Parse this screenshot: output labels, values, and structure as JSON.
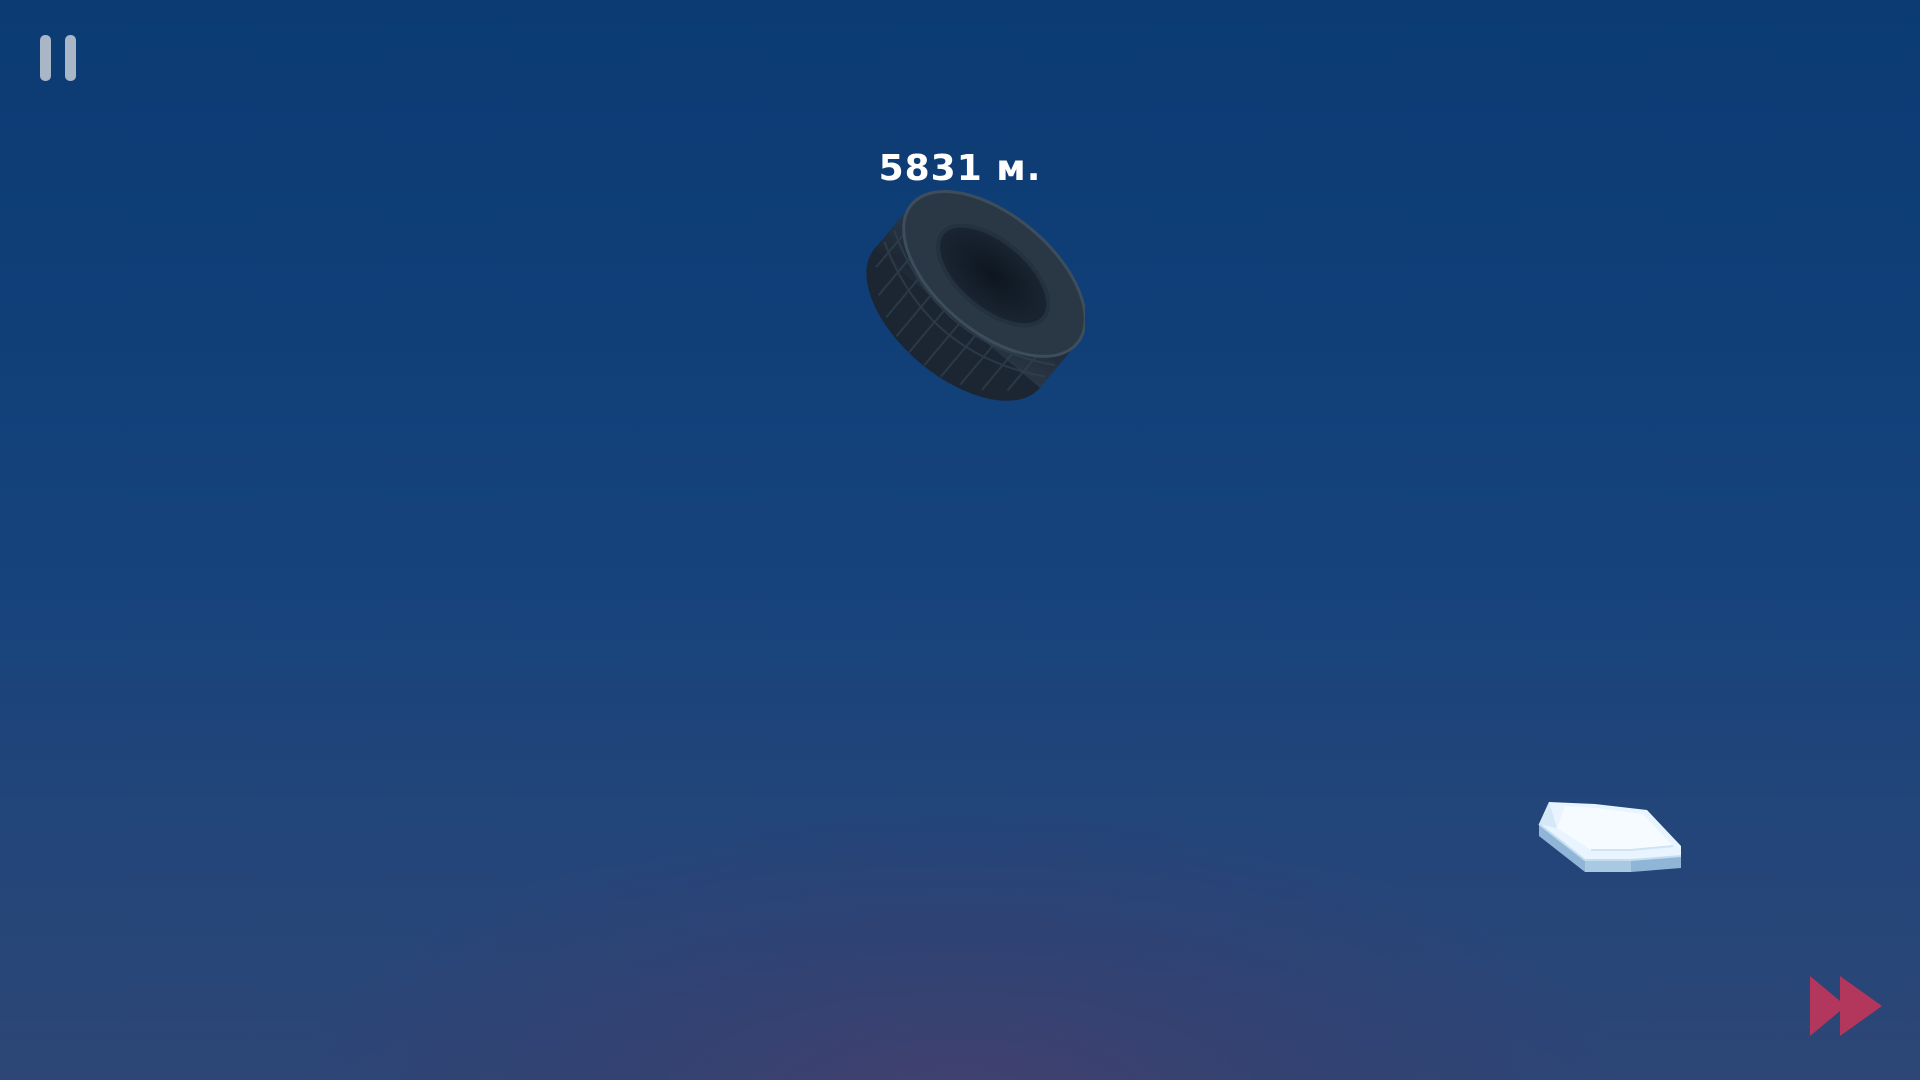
{
  "hud": {
    "distance_text": "5831 м.",
    "pause_icon": "pause-icon",
    "fast_forward_icon": "fast-forward-icon"
  },
  "scene": {
    "objects": [
      "tire",
      "ice-block-platform"
    ]
  },
  "colors": {
    "sky_top": "#0c3b74",
    "sky_bottom": "#2d4676",
    "pause_icon": "#a9b6c6",
    "fast_forward": "#b3365c",
    "distance_text": "#ffffff"
  }
}
